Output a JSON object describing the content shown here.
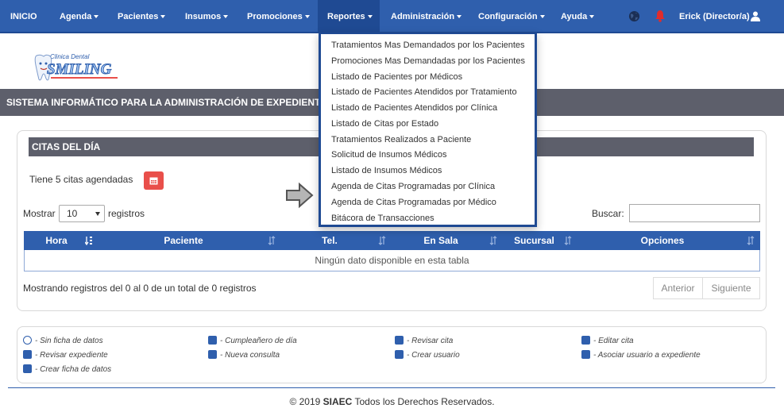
{
  "nav": {
    "inicio": "INICIO",
    "agenda": "Agenda",
    "pacientes": "Pacientes",
    "insumos": "Insumos",
    "promociones": "Promociones",
    "reportes": "Reportes",
    "administracion": "Administración",
    "configuracion": "Configuración",
    "ayuda": "Ayuda",
    "user": "Erick (Director/a)"
  },
  "logo": {
    "line1": "Clinica Dental",
    "line2": "SMILING"
  },
  "system_bar": "SISTEMA INFORMÁTICO PARA LA ADMINISTRACIÓN DE EXPEDIENTES CLÍNICOS",
  "panel": {
    "title": "CITAS DEL DÍA",
    "citas_text": "Tiene 5 citas agendadas",
    "mostrar": "Mostrar",
    "length_value": "10",
    "registros": "registros",
    "buscar": "Buscar:",
    "search_value": "",
    "columns": [
      "Hora",
      "Paciente",
      "Tel.",
      "En Sala",
      "Sucursal",
      "Opciones"
    ],
    "empty": "Ningún dato disponible en esta tabla",
    "info": "Mostrando registros del 0 al 0 de un total de 0 registros",
    "prev": "Anterior",
    "next": "Siguiente"
  },
  "legend": [
    "- Sin ficha de datos",
    "- Cumpleañero de día",
    "- Revisar cita",
    "- Editar cita",
    "- Revisar expediente",
    "- Nueva consulta",
    "- Crear usuario",
    "- Asociar usuario a expediente",
    "- Crear ficha de datos"
  ],
  "footer": {
    "prefix": "© 2019",
    "brand": "SIAEC",
    "suffix": "Todos los Derechos Reservados."
  },
  "reportes_menu": [
    "Tratamientos Mas Demandados por los Pacientes",
    "Promociones Mas Demandadas por los Pacientes",
    "Listado de Pacientes por Médicos",
    "Listado de Pacientes Atendidos por Tratamiento",
    "Listado de Pacientes Atendidos por Clínica",
    "Listado de Citas por Estado",
    "Tratamientos Realizados a Paciente",
    "Solicitud de Insumos Médicos",
    "Listado de Insumos Médicos",
    "Agenda de Citas Programadas por Clínica",
    "Agenda de Citas Programadas por Médico",
    "Bitácora de Transacciones"
  ],
  "colors": {
    "primary": "#2f5fad",
    "dark_bar": "#5d5f6b",
    "danger": "#e94f4a",
    "border": "#1f4a93"
  },
  "icons": [
    "globe-icon",
    "bell-icon",
    "user-icon",
    "calendar-icon",
    "arrow-right-icon",
    "sort-icon"
  ]
}
